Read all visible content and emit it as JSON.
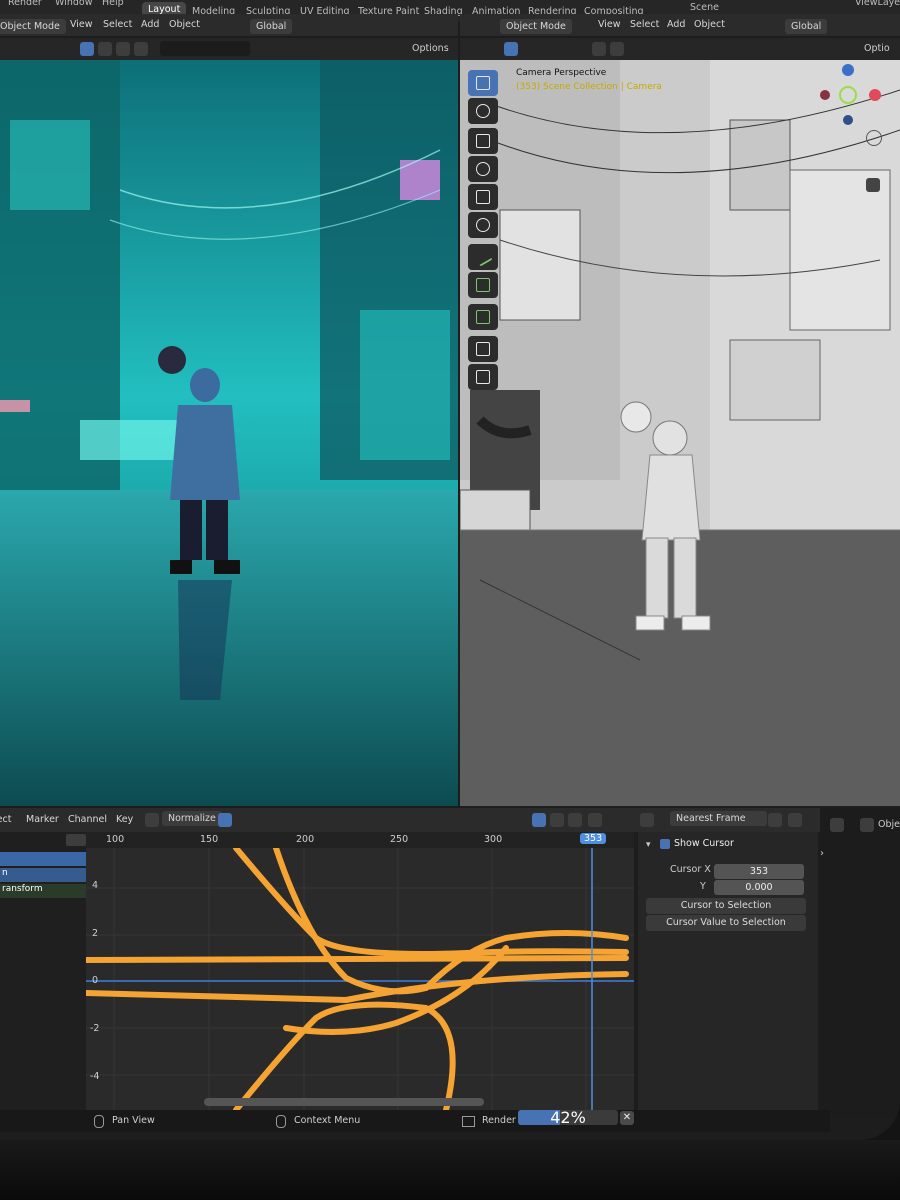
{
  "topbar": {
    "menus": [
      "Render",
      "Window",
      "Help"
    ],
    "workspaces": [
      "Layout",
      "Modeling",
      "Sculpting",
      "UV Editing",
      "Texture Paint",
      "Shading",
      "Animation",
      "Rendering",
      "Compositing"
    ],
    "active_workspace": "Layout",
    "scene": "Scene",
    "view_layer": "ViewLaye"
  },
  "left_viewport": {
    "mode": "Object Mode",
    "menus": [
      "View",
      "Select",
      "Add",
      "Object"
    ],
    "orientation": "Global",
    "options": "Options"
  },
  "right_viewport": {
    "mode": "Object Mode",
    "menus": [
      "View",
      "Select",
      "Add",
      "Object"
    ],
    "orientation": "Global",
    "options": "Optio",
    "overlay_title": "Camera Perspective",
    "overlay_subtitle": "(353) Scene Collection | Camera"
  },
  "graph_editor": {
    "menus": [
      "lect",
      "Marker",
      "Channel",
      "Key"
    ],
    "normalize": "Normalize",
    "snap": "Nearest Frame",
    "frame_ticks": [
      "100",
      "150",
      "200",
      "250",
      "300"
    ],
    "current_frame": "353",
    "value_ticks": [
      "4",
      "2",
      "0",
      "-2",
      "-4"
    ],
    "channels": [
      "",
      "n",
      "ransform"
    ],
    "curve_color": "#f5a332",
    "cursor_color": "#4d8fe0"
  },
  "view_panel": {
    "show_cursor": "Show Cursor",
    "cursor_x_label": "Cursor X",
    "cursor_x": "353",
    "y_label": "Y",
    "y_value": "0.000",
    "btn_cursor_to_selection": "Cursor to Selection",
    "btn_cursor_value": "Cursor Value to Selection"
  },
  "status_bar": {
    "pan": "Pan View",
    "context": "Context Menu",
    "render_label": "Render",
    "render_progress_pct": 42,
    "render_progress_text": "42%"
  },
  "right_edge": {
    "label": "Obje"
  }
}
